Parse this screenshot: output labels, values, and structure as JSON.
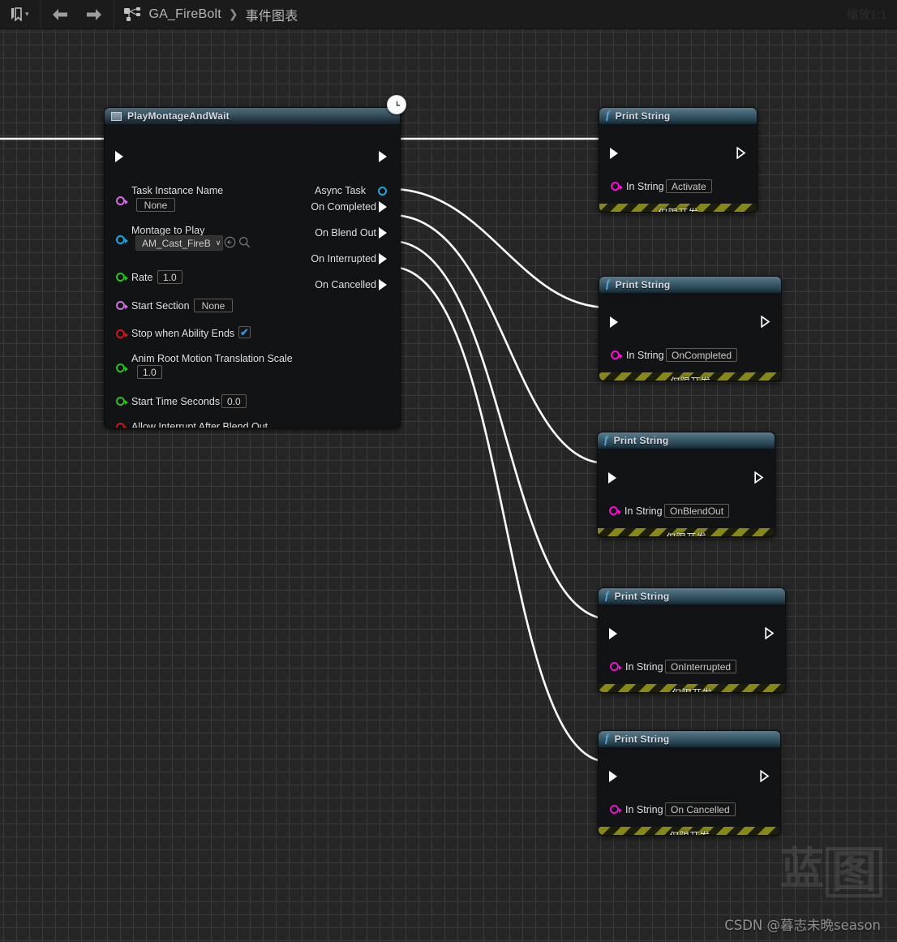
{
  "toolbar": {
    "bookmark_icon": "bookmark-icon",
    "bookmark_chevron": "▾",
    "back_icon": "arrow-left-icon",
    "forward_icon": "arrow-right-icon",
    "graph_icon": "node-graph-icon",
    "breadcrumb_asset": "GA_FireBolt",
    "breadcrumb_sep": "❯",
    "breadcrumb_graph": "事件图表",
    "zoom_label": "缩放1:1"
  },
  "colors": {
    "canvas_bg": "#262626",
    "grid_minor": "#3a3a3a",
    "grid_major": "#1a1a1a",
    "node_body": "#111314",
    "header_blue": "#3d5765",
    "wire_exec": "#ffffff",
    "pin_name": "#cf6fe0",
    "pin_object": "#1ea8e0",
    "pin_float": "#2fbf25",
    "pin_bool": "#c81a1a",
    "pin_string": "#f010d0",
    "dev_only_stripe": "#87871a",
    "checkbox_check": "#2f8fe0"
  },
  "main_node": {
    "title": "PlayMontageAndWait",
    "icon": "node-box-icon",
    "badge_icon": "clock-icon",
    "inputs": [
      {
        "label": "",
        "pin": "exec-pin-in",
        "type": "exec"
      },
      {
        "label": "Task Instance Name",
        "pin": "pin-task-instance-name",
        "type": "name",
        "value": "None"
      },
      {
        "label": "Montage to Play",
        "pin": "pin-montage-to-play",
        "type": "object",
        "value": "AM_Cast_FireB",
        "carat": "∨",
        "browse_icon": "browse-icon",
        "search_icon": "search-icon"
      },
      {
        "label": "Rate",
        "pin": "pin-rate",
        "type": "float",
        "value": "1.0"
      },
      {
        "label": "Start Section",
        "pin": "pin-start-section",
        "type": "name",
        "value": "None"
      },
      {
        "label": "Stop when Ability Ends",
        "pin": "pin-stop-when-ability-ends",
        "type": "bool",
        "value": true,
        "check": "✔"
      },
      {
        "label": "Anim Root Motion Translation Scale",
        "pin": "pin-anim-root-motion-translation-scale",
        "type": "float",
        "value": "1.0"
      },
      {
        "label": "Start Time Seconds",
        "pin": "pin-start-time-seconds",
        "type": "float",
        "value": "0.0"
      },
      {
        "label": "Allow Interrupt After Blend Out",
        "pin": "pin-allow-interrupt-after-blend-out",
        "type": "bool",
        "value": false
      }
    ],
    "outputs": [
      {
        "label": "",
        "pin": "exec-pin-out",
        "type": "exec"
      },
      {
        "label": "Async Task",
        "pin": "pin-async-task",
        "type": "object"
      },
      {
        "label": "On Completed",
        "pin": "exec-pin-on-completed",
        "type": "exec"
      },
      {
        "label": "On Blend Out",
        "pin": "exec-pin-on-blend-out",
        "type": "exec"
      },
      {
        "label": "On Interrupted",
        "pin": "exec-pin-on-interrupted",
        "type": "exec"
      },
      {
        "label": "On Cancelled",
        "pin": "exec-pin-on-cancelled",
        "type": "exec"
      }
    ]
  },
  "print_nodes": [
    {
      "title": "Print String",
      "icon": "function-icon",
      "in_label": "In String",
      "in_value": "Activate",
      "dev_only": "仅限开发",
      "collapse": "∨"
    },
    {
      "title": "Print String",
      "icon": "function-icon",
      "in_label": "In String",
      "in_value": "OnCompleted",
      "dev_only": "仅限开发",
      "collapse": "∨"
    },
    {
      "title": "Print String",
      "icon": "function-icon",
      "in_label": "In String",
      "in_value": "OnBlendOut",
      "dev_only": "仅限开发",
      "collapse": "∨"
    },
    {
      "title": "Print String",
      "icon": "function-icon",
      "in_label": "In String",
      "in_value": "OnInterrupted",
      "dev_only": "仅限开发",
      "collapse": "∨"
    },
    {
      "title": "Print String",
      "icon": "function-icon",
      "in_label": "In String",
      "in_value": "On Cancelled",
      "dev_only": "仅限开发",
      "collapse": "∨"
    }
  ],
  "watermark": {
    "logo_char_1": "蓝",
    "logo_char_2": "图",
    "credit": "CSDN @暮志未晩season"
  }
}
